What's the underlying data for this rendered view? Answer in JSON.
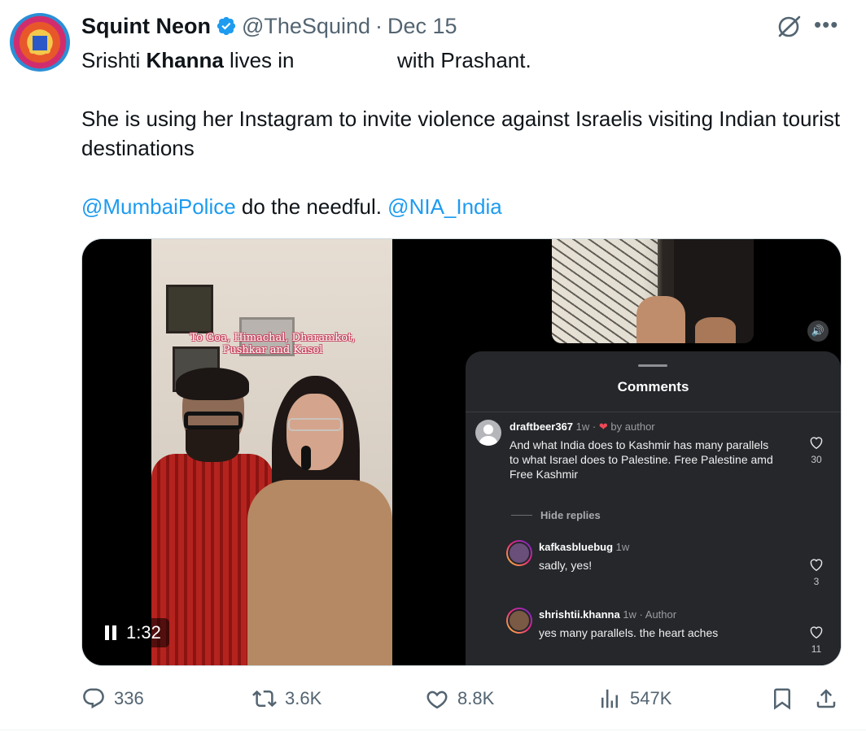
{
  "author": {
    "name": "Squint Neon",
    "handle": "@TheSquind",
    "separator": "·",
    "date": "Dec 15"
  },
  "tweet": {
    "line1_part1": "Srishti ",
    "line1_bold": "Khanna",
    "line1_part2": " lives in ",
    "line1_part3": " with Prashant.",
    "paragraph2": "She is using her Instagram to invite violence against Israelis visiting Indian tourist destinations",
    "mention1": "@MumbaiPolice",
    "paragraph3_middle": " do the needful. ",
    "mention2": "@NIA_India"
  },
  "video_left": {
    "overlay_text": "To Goa, Himachal, Dharamkot, Pushkar and Kasol",
    "timestamp": "1:32"
  },
  "comments_sheet": {
    "title": "Comments",
    "hide_replies": "Hide replies",
    "comments": [
      {
        "username": "draftbeer367",
        "age": "1w",
        "by_author": "by author",
        "text": "And what India does to Kashmir has many parallels to what Israel does to Palestine. Free Palestine amd Free Kashmir",
        "likes": "30"
      },
      {
        "username": "kafkasbluebug",
        "age": "1w",
        "text": "sadly, yes!",
        "likes": "3"
      },
      {
        "username": "shrishtii.khanna",
        "age": "1w · Author",
        "text": "yes many parallels. the heart aches",
        "likes": "11"
      }
    ]
  },
  "actions": {
    "replies": "336",
    "reposts": "3.6K",
    "likes": "8.8K",
    "views": "547K"
  },
  "colors": {
    "link": "#1d9bf0",
    "muted": "#536471",
    "verified": "#1d9bf0"
  }
}
